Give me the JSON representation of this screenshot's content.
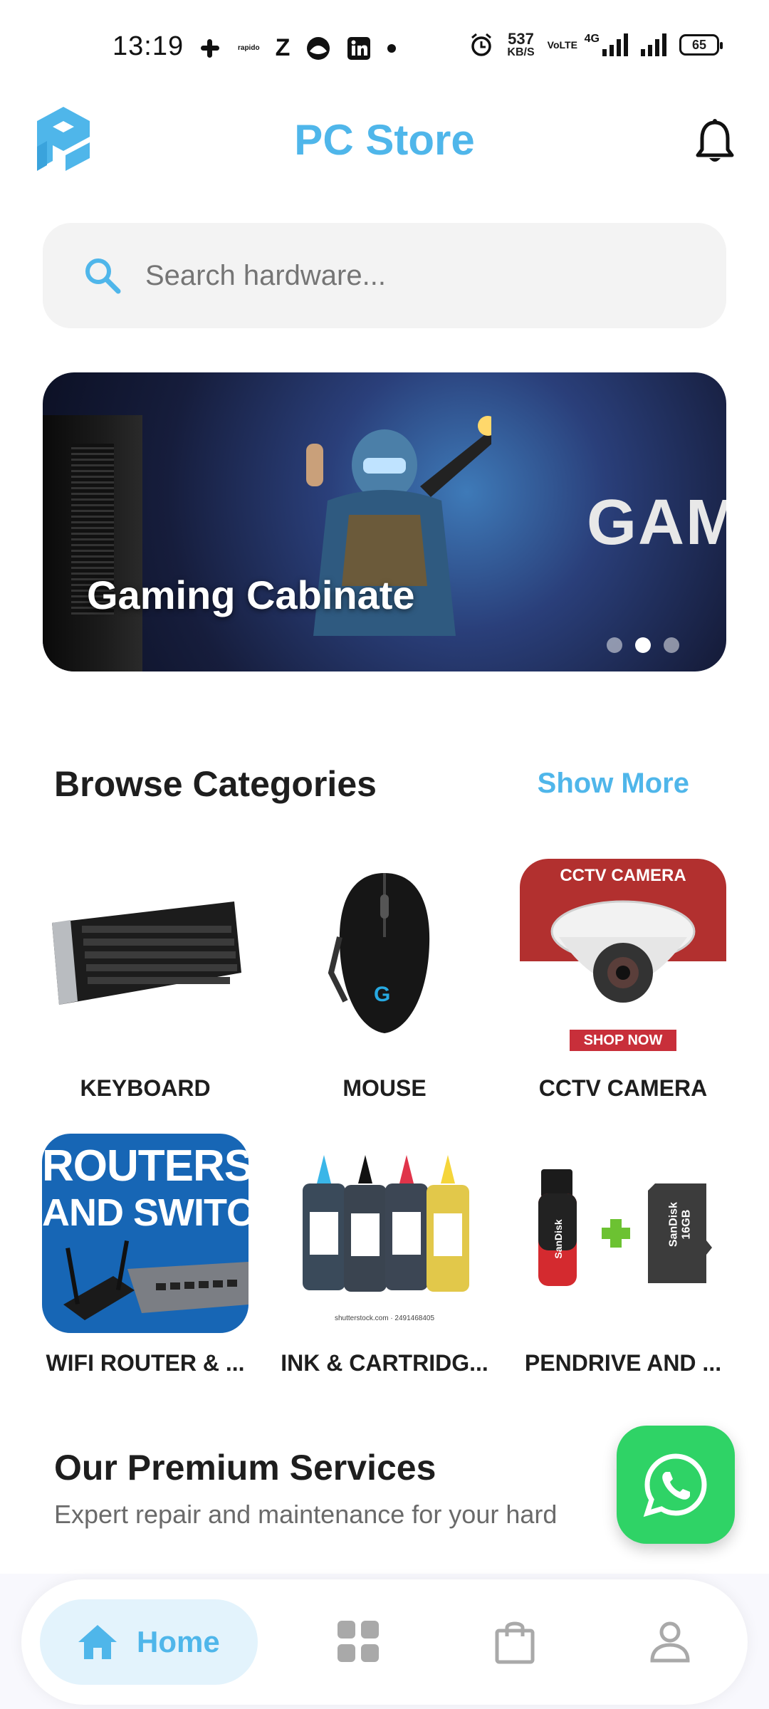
{
  "status_bar": {
    "time": "13:19",
    "left_icons": [
      "slack-icon",
      "rapido-icon",
      "zomato-icon",
      "browser-icon",
      "linkedin-icon",
      "dot-icon"
    ],
    "net_speed_value": "537",
    "net_speed_unit": "KB/S",
    "volte": "VoLTE",
    "network": "4G",
    "battery": "65"
  },
  "header": {
    "title": "PC Store",
    "logo": "pc-store-logo",
    "bell": "bell-icon"
  },
  "search": {
    "placeholder": "Search hardware..."
  },
  "banner": {
    "title": "Gaming Cabinate",
    "side_text": "GAM",
    "dots": 3,
    "active_dot": 2
  },
  "categories": {
    "title": "Browse Categories",
    "show_more": "Show More",
    "items": [
      {
        "label": "KEYBOARD"
      },
      {
        "label": "MOUSE"
      },
      {
        "label": "CCTV CAMERA",
        "img_top": "CCTV CAMERA",
        "img_bottom": "SHOP NOW"
      },
      {
        "label": "WIFI ROUTER & ...",
        "img_line1": "ROUTERS",
        "img_line2": "AND SWITCHE"
      },
      {
        "label": "INK & CARTRIDG...",
        "img_caption": "shutterstock.com · 2491468405"
      },
      {
        "label": "PENDRIVE AND ...",
        "img_brand": "SanDisk",
        "img_capacity": "16GB"
      }
    ]
  },
  "premium": {
    "title": "Our Premium Services",
    "subtitle": "Expert repair and maintenance for your hard"
  },
  "nav": {
    "home": "Home",
    "items": [
      "home-icon",
      "categories-icon",
      "bag-icon",
      "profile-icon"
    ]
  },
  "colors": {
    "accent": "#4fb6ea",
    "whatsapp": "#2fd366"
  }
}
